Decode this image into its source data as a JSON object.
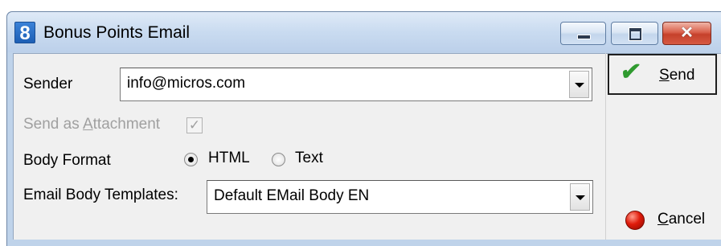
{
  "window": {
    "title": "Bonus Points Email",
    "app_icon_glyph": "8",
    "controls": {
      "minimize": "minimize-icon",
      "maximize": "maximize-icon",
      "close": "close-icon",
      "close_glyph": "✕"
    }
  },
  "form": {
    "sender_label": "Sender",
    "sender_value": "info@micros.com",
    "attachment": {
      "label_pre": "Send as ",
      "label_accel": "A",
      "label_post": "ttachment",
      "checked": true,
      "enabled": false,
      "check_glyph": "✓"
    },
    "body_format_label": "Body Format",
    "body_format_options": [
      {
        "label": "HTML",
        "selected": true
      },
      {
        "label": "Text",
        "selected": false
      }
    ],
    "templates_label": "Email Body Templates:",
    "template_value": "Default EMail Body EN"
  },
  "actions": {
    "send": {
      "accel": "S",
      "rest": "end",
      "icon": "checkmark-icon",
      "icon_glyph": "✔"
    },
    "cancel": {
      "accel": "C",
      "rest": "ancel",
      "icon": "red-stop-icon"
    }
  },
  "colors": {
    "titlebar": "#c9dbf0",
    "client": "#f0f0f0",
    "close_button": "#c5402b",
    "send_check": "#2f9a2f",
    "cancel_dot": "#e01b0b"
  }
}
